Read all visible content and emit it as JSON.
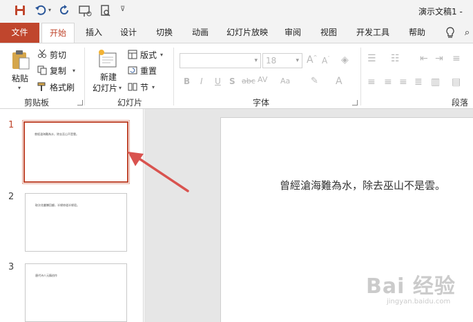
{
  "window": {
    "title": "演示文稿1 -"
  },
  "tabs": [
    "文件",
    "开始",
    "插入",
    "设计",
    "切换",
    "动画",
    "幻灯片放映",
    "审阅",
    "视图",
    "开发工具",
    "帮助"
  ],
  "ribbon": {
    "clipboard": {
      "paste": "粘贴",
      "cut": "剪切",
      "copy": "复制",
      "format_painter": "格式刷",
      "label": "剪贴板"
    },
    "slides": {
      "new_slide_line1": "新建",
      "new_slide_line2": "幻灯片",
      "layout": "版式",
      "reset": "重置",
      "section": "节",
      "label": "幻灯片"
    },
    "font": {
      "font_name": "",
      "font_size": "18",
      "label": "字体",
      "buttons": [
        "B",
        "I",
        "U",
        "S",
        "abc",
        "AV",
        "Aa"
      ]
    },
    "paragraph": {
      "label": "段落"
    }
  },
  "slides": [
    {
      "number": "1",
      "text": "曾經滄海難為水，除去巫山不是雲。",
      "selected": true
    },
    {
      "number": "2",
      "text": "取次花叢懶回顧，半緣修道半緣君。",
      "selected": false
    },
    {
      "number": "3",
      "text": "唐代诗人元稹创作",
      "selected": false
    }
  ],
  "editor": {
    "content": "曾經滄海難為水，除去巫山不是雲。"
  },
  "watermark": {
    "brand": "Bai 经验",
    "url": "jingyan.baidu.com"
  },
  "colors": {
    "accent": "#c0462d",
    "arrow": "#d9534f"
  }
}
